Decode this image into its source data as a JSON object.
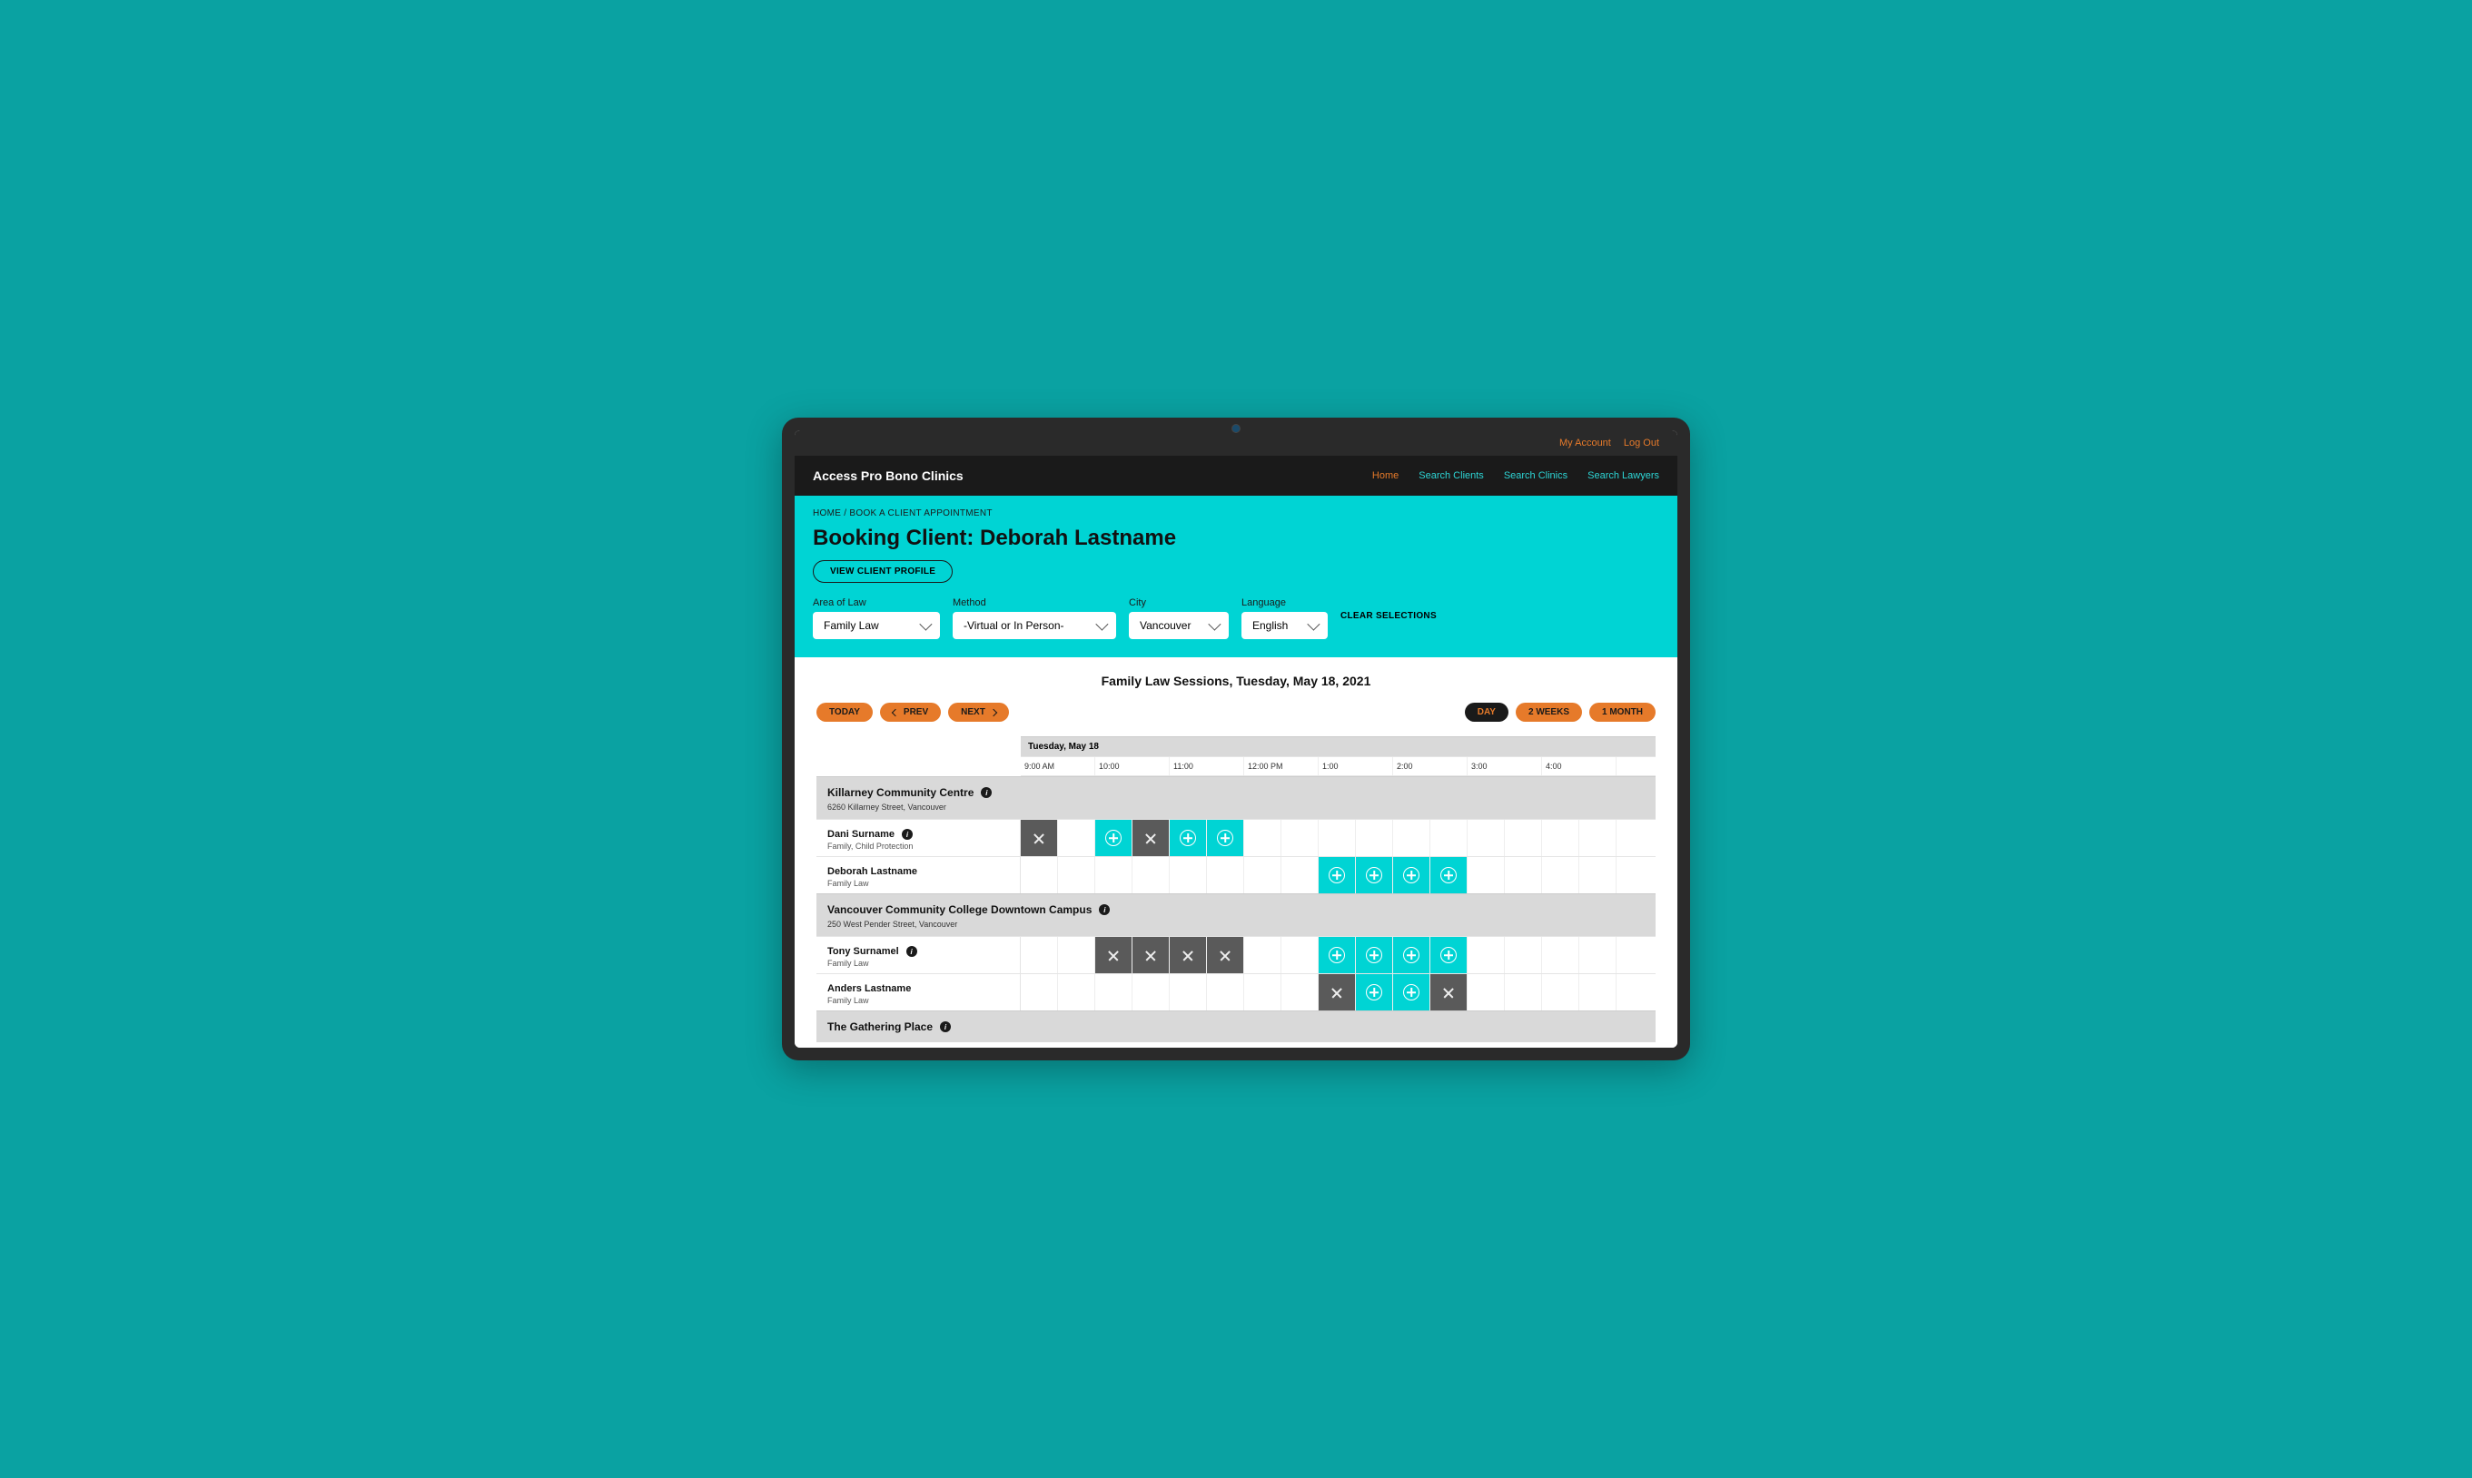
{
  "topbar": {
    "account": "My Account",
    "logout": "Log Out"
  },
  "brand": "Access Pro Bono Clinics",
  "nav": {
    "home": "Home",
    "clients": "Search Clients",
    "clinics": "Search Clinics",
    "lawyers": "Search Lawyers"
  },
  "breadcrumb": "HOME / BOOK A CLIENT APPOINTMENT",
  "page_title": "Booking Client: Deborah Lastname",
  "view_profile": "VIEW CLIENT PROFILE",
  "filters": {
    "area": {
      "label": "Area of Law",
      "value": "Family Law"
    },
    "method": {
      "label": "Method",
      "value": "-Virtual or In Person-"
    },
    "city": {
      "label": "City",
      "value": "Vancouver"
    },
    "language": {
      "label": "Language",
      "value": "English"
    },
    "clear": "CLEAR SELECTIONS"
  },
  "section_title": "Family Law Sessions, Tuesday, May 18, 2021",
  "controls": {
    "today": "TODAY",
    "prev": "PREV",
    "next": "NEXT",
    "day": "DAY",
    "twoweeks": "2 WEEKS",
    "month": "1 MONTH"
  },
  "date_header": "Tuesday, May 18",
  "times": [
    "9:00 AM",
    "10:00",
    "11:00",
    "12:00 PM",
    "1:00",
    "2:00",
    "3:00",
    "4:00"
  ],
  "locations": [
    {
      "name": "Killarney Community Centre",
      "addr": "6260 Killarney Street, Vancouver",
      "people": [
        {
          "name": "Dani Surname",
          "meta": "Family, Child Protection",
          "info": true,
          "slots": [
            "x",
            "",
            "plus",
            "x",
            "plus",
            "plus",
            "",
            "",
            "",
            "",
            "",
            "",
            "",
            "",
            "",
            ""
          ]
        },
        {
          "name": "Deborah Lastname",
          "meta": "Family Law",
          "info": false,
          "slots": [
            "",
            "",
            "",
            "",
            "",
            "",
            "",
            "",
            "plus",
            "plus",
            "plus",
            "plus",
            "",
            "",
            "",
            ""
          ]
        }
      ]
    },
    {
      "name": "Vancouver Community College Downtown Campus",
      "addr": "250 West Pender Street, Vancouver",
      "people": [
        {
          "name": "Tony Surnamel",
          "meta": "Family Law",
          "info": true,
          "slots": [
            "",
            "",
            "x",
            "x",
            "x",
            "x",
            "",
            "",
            "plus",
            "plus",
            "plus",
            "plus",
            "",
            "",
            "",
            ""
          ]
        },
        {
          "name": "Anders Lastname",
          "meta": "Family Law",
          "info": false,
          "slots": [
            "",
            "",
            "",
            "",
            "",
            "",
            "",
            "",
            "x",
            "plus",
            "plus",
            "x",
            "",
            "",
            "",
            ""
          ]
        }
      ]
    },
    {
      "name": "The Gathering Place",
      "addr": "",
      "people": []
    }
  ]
}
